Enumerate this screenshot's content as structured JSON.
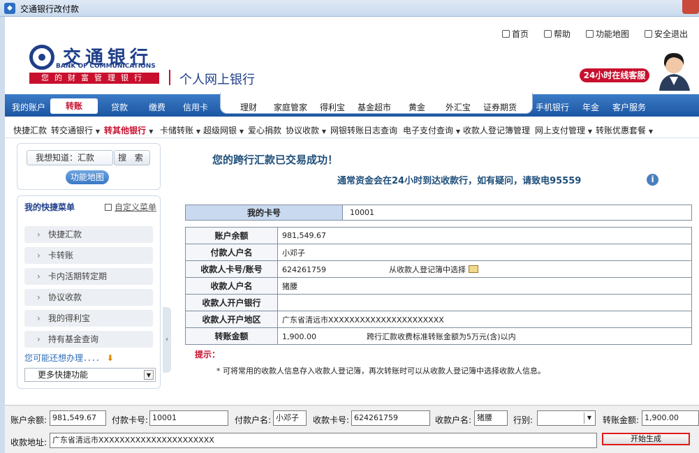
{
  "window": {
    "title": "交通银行改付款"
  },
  "header": {
    "top_links": [
      "首页",
      "帮助",
      "功能地图",
      "安全退出"
    ],
    "logo_cn": "交通银行",
    "logo_en": "BANK OF COMMUNICATIONS",
    "slogan": "您的财富管理银行",
    "product": "个人网上银行",
    "service_badge": "24小时在线客服"
  },
  "nav": {
    "left": [
      "我的账户",
      "转账",
      "贷款",
      "缴费",
      "信用卡"
    ],
    "active": "转账",
    "middle": [
      "理财",
      "家庭管家",
      "得利宝",
      "基金超市",
      "黄金",
      "外汇宝",
      "证券期货"
    ],
    "right": [
      "手机银行",
      "年金",
      "客户服务"
    ]
  },
  "subnav": [
    {
      "label": "快捷汇款",
      "dd": false
    },
    {
      "label": "转交通银行",
      "dd": true
    },
    {
      "label": "转其他银行",
      "dd": true,
      "active": true
    },
    {
      "label": "卡储转账",
      "dd": true
    },
    {
      "label": "超级网银",
      "dd": true
    },
    {
      "label": "爱心捐款",
      "dd": false
    },
    {
      "label": "协议收款",
      "dd": true
    },
    {
      "label": "网银转账日志查询",
      "dd": false
    },
    {
      "label": "电子支付查询",
      "dd": true
    },
    {
      "label": "收款人登记簿管理",
      "dd": false
    },
    {
      "label": "网上支付管理",
      "dd": true
    },
    {
      "label": "转账优惠套餐",
      "dd": true
    }
  ],
  "sidebar": {
    "search_value": "我想知道：汇款",
    "search_btn": "搜 索",
    "map_btn": "功能地图",
    "quick_title": "我的快捷菜单",
    "custom_link": "自定义菜单",
    "items": [
      "快捷汇款",
      "卡转账",
      "卡内活期转定期",
      "协议收款",
      "我的得利宝",
      "持有基金查询"
    ],
    "maybe": "您可能还想办理．．．．",
    "more_select": "更多快捷功能"
  },
  "main": {
    "success": "您的跨行汇款已交易成功！",
    "note": "通常资金会在24小时到达收款行，如有疑问，请致电95559",
    "card_label": "我的卡号",
    "card_value": "10001",
    "rows": [
      {
        "label": "账户余额",
        "value": "981,549.67"
      },
      {
        "label": "付款人户名",
        "value": "小邓子"
      },
      {
        "label": "收款人卡号/账号",
        "value": "624261759",
        "extra": "从收款人登记簿中选择"
      },
      {
        "label": "收款人户名",
        "value": "猪腰"
      },
      {
        "label": "收款人开户银行",
        "value": ""
      },
      {
        "label": "收款人开户地区",
        "value": "广东省清远市XXXXXXXXXXXXXXXXXXXXXX"
      },
      {
        "label": "转账金额",
        "value": "1,900.00",
        "extra": "跨行汇款收费标准转账金额为5万元(含)以内"
      }
    ],
    "hint_title": "提示：",
    "hint_text": "* 可将常用的收款人信息存入收款人登记簿，再次转账时可以从收款人登记簿中选择收款人信息。"
  },
  "form": {
    "balance_label": "账户余额:",
    "balance": "981,549.67",
    "paycard_label": "付款卡号:",
    "paycard": "10001",
    "payname_label": "付款户名:",
    "payname": "小邓子",
    "recvcard_label": "收款卡号:",
    "recvcard": "624261759",
    "recvname_label": "收款户名:",
    "recvname": "猪腰",
    "bank_label": "行别:",
    "bank": "",
    "amount_label": "转账金额:",
    "amount": "1,900.00",
    "addr_label": "收款地址:",
    "addr": "广东省清远市XXXXXXXXXXXXXXXXXXXXXX",
    "generate_btn": "开始生成"
  }
}
